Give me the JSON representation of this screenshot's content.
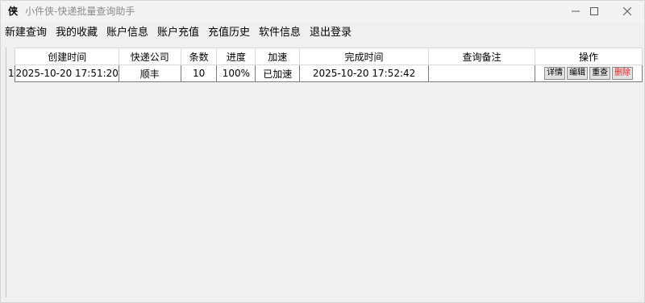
{
  "window": {
    "icon_glyph": "侠",
    "title": "小件侠-快递批量查询助手"
  },
  "menu": {
    "items": [
      "新建查询",
      "我的收藏",
      "账户信息",
      "账户充值",
      "充值历史",
      "软件信息",
      "退出登录"
    ]
  },
  "table": {
    "headers": [
      "创建时间",
      "快递公司",
      "条数",
      "进度",
      "加速",
      "完成时间",
      "查询备注",
      "操作"
    ],
    "rows": [
      {
        "row_number": "1",
        "created": "2025-10-20 17:51:20",
        "company": "顺丰",
        "count": "10",
        "progress": "100%",
        "accel": "已加速",
        "finished": "2025-10-20 17:52:42",
        "note": "",
        "actions": [
          "详情",
          "编辑",
          "重查",
          "删除"
        ]
      }
    ]
  },
  "colors": {
    "delete_text": "#e02020",
    "title_text": "#8a8a8a"
  }
}
